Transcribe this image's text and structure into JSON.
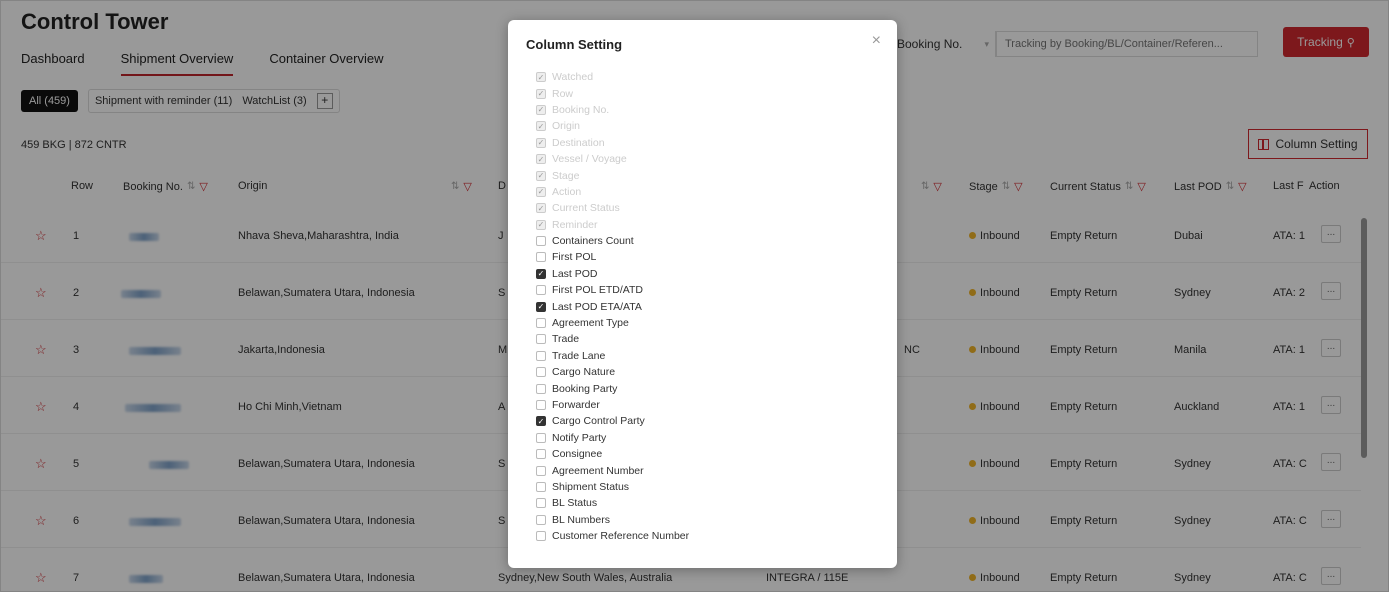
{
  "header": {
    "title": "Control Tower",
    "tabs": [
      {
        "label": "Dashboard",
        "active": false
      },
      {
        "label": "Shipment Overview",
        "active": true
      },
      {
        "label": "Container Overview",
        "active": false
      }
    ],
    "search_type": "Booking No.",
    "search_placeholder": "Tracking by Booking/BL/Container/Referen...",
    "tracking_label": "Tracking"
  },
  "filters": {
    "all": "All (459)",
    "reminder": "Shipment with reminder (11)",
    "watchlist": "WatchList (3)",
    "add": "+"
  },
  "summary": {
    "counts": "459 BKG | 872 CNTR",
    "column_setting_label": "Column Setting"
  },
  "table": {
    "headers": {
      "row": "Row",
      "booking": "Booking No.",
      "origin": "Origin",
      "destination": "D",
      "stage": "Stage",
      "current_status": "Current Status",
      "last_pod": "Last POD",
      "last_pod_eta": "Last F",
      "action": "Action"
    },
    "rows": [
      {
        "row": "1",
        "origin": "Nhava Sheva,Maharashtra, India",
        "dest": "J",
        "vessel": "",
        "stage": "Inbound",
        "status": "Empty Return",
        "pod": "Dubai",
        "ata": "ATA: 1"
      },
      {
        "row": "2",
        "origin": "Belawan,Sumatera Utara, Indonesia",
        "dest": "S",
        "vessel": "",
        "stage": "Inbound",
        "status": "Empty Return",
        "pod": "Sydney",
        "ata": "ATA: 2"
      },
      {
        "row": "3",
        "origin": "Jakarta,Indonesia",
        "dest": "M",
        "vessel": "NC",
        "stage": "Inbound",
        "status": "Empty Return",
        "pod": "Manila",
        "ata": "ATA: 1"
      },
      {
        "row": "4",
        "origin": "Ho Chi Minh,Vietnam",
        "dest": "A",
        "vessel": "",
        "stage": "Inbound",
        "status": "Empty Return",
        "pod": "Auckland",
        "ata": "ATA: 1"
      },
      {
        "row": "5",
        "origin": "Belawan,Sumatera Utara, Indonesia",
        "dest": "S",
        "vessel": "",
        "stage": "Inbound",
        "status": "Empty Return",
        "pod": "Sydney",
        "ata": "ATA: C"
      },
      {
        "row": "6",
        "origin": "Belawan,Sumatera Utara, Indonesia",
        "dest": "S",
        "vessel": "",
        "stage": "Inbound",
        "status": "Empty Return",
        "pod": "Sydney",
        "ata": "ATA: C"
      },
      {
        "row": "7",
        "origin": "Belawan,Sumatera Utara, Indonesia",
        "dest": "Sydney,New South Wales, Australia",
        "vessel": "INTEGRA / 115E",
        "stage": "Inbound",
        "status": "Empty Return",
        "pod": "Sydney",
        "ata": "ATA: C"
      }
    ],
    "action_label": "..."
  },
  "modal": {
    "title": "Column Setting",
    "close": "×",
    "options": [
      {
        "label": "Watched",
        "checked": true,
        "disabled": true
      },
      {
        "label": "Row",
        "checked": true,
        "disabled": true
      },
      {
        "label": "Booking No.",
        "checked": true,
        "disabled": true
      },
      {
        "label": "Origin",
        "checked": true,
        "disabled": true
      },
      {
        "label": "Destination",
        "checked": true,
        "disabled": true
      },
      {
        "label": "Vessel / Voyage",
        "checked": true,
        "disabled": true
      },
      {
        "label": "Stage",
        "checked": true,
        "disabled": true
      },
      {
        "label": "Action",
        "checked": true,
        "disabled": true
      },
      {
        "label": "Current Status",
        "checked": true,
        "disabled": true
      },
      {
        "label": "Reminder",
        "checked": true,
        "disabled": true
      },
      {
        "label": "Containers Count",
        "checked": false,
        "disabled": false
      },
      {
        "label": "First POL",
        "checked": false,
        "disabled": false
      },
      {
        "label": "Last POD",
        "checked": true,
        "disabled": false
      },
      {
        "label": "First POL ETD/ATD",
        "checked": false,
        "disabled": false
      },
      {
        "label": "Last POD ETA/ATA",
        "checked": true,
        "disabled": false
      },
      {
        "label": "Agreement Type",
        "checked": false,
        "disabled": false
      },
      {
        "label": "Trade",
        "checked": false,
        "disabled": false
      },
      {
        "label": "Trade Lane",
        "checked": false,
        "disabled": false
      },
      {
        "label": "Cargo Nature",
        "checked": false,
        "disabled": false
      },
      {
        "label": "Booking Party",
        "checked": false,
        "disabled": false
      },
      {
        "label": "Forwarder",
        "checked": false,
        "disabled": false
      },
      {
        "label": "Cargo Control Party",
        "checked": true,
        "disabled": false
      },
      {
        "label": "Notify Party",
        "checked": false,
        "disabled": false
      },
      {
        "label": "Consignee",
        "checked": false,
        "disabled": false
      },
      {
        "label": "Agreement Number",
        "checked": false,
        "disabled": false
      },
      {
        "label": "Shipment Status",
        "checked": false,
        "disabled": false
      },
      {
        "label": "BL Status",
        "checked": false,
        "disabled": false
      },
      {
        "label": "BL Numbers",
        "checked": false,
        "disabled": false
      },
      {
        "label": "Customer Reference Number",
        "checked": false,
        "disabled": false
      }
    ]
  },
  "colors": {
    "accent": "#d0282f",
    "stage_dot": "#f0b429"
  }
}
